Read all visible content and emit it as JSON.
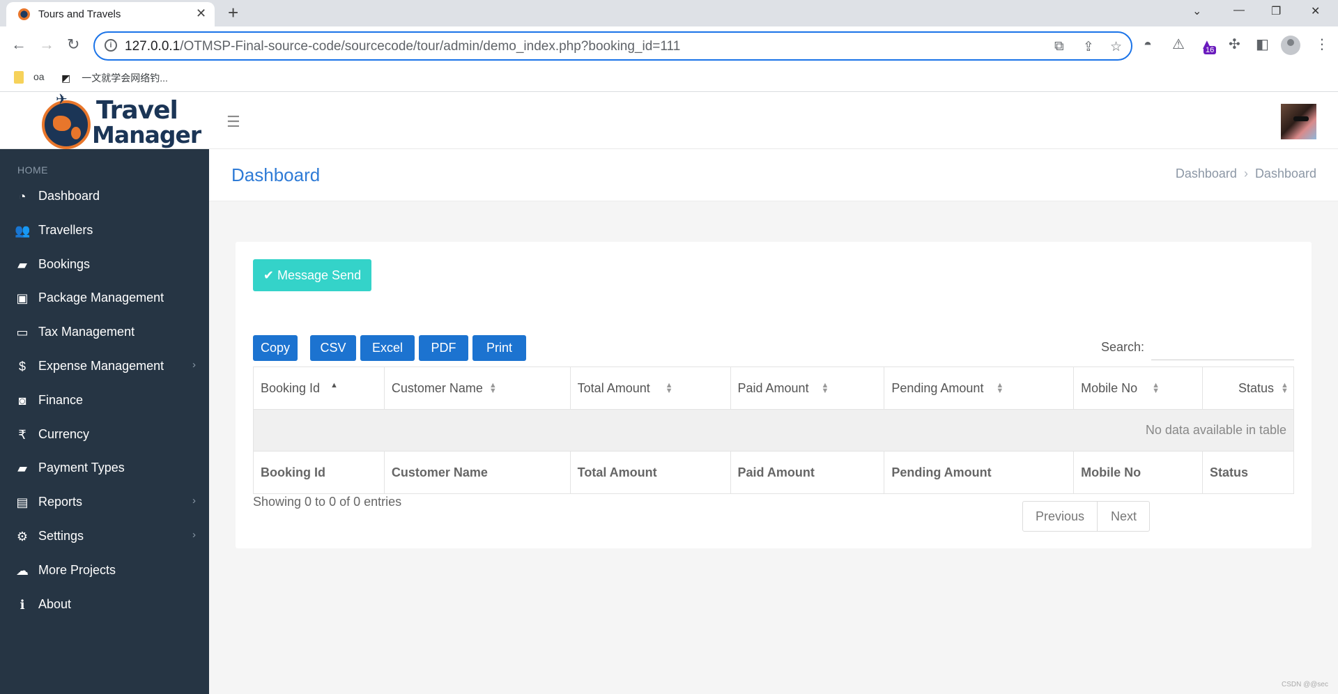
{
  "browser": {
    "tab_title": "Tours and Travels",
    "url_host": "127.0.0.1",
    "url_path": "/OTMSP-Final-source-code/sourcecode/tour/admin/demo_index.php?booking_id=111",
    "extension_badge": "16",
    "bookmarks": [
      {
        "label": "oa"
      },
      {
        "label": "一文就学会网络钓..."
      }
    ]
  },
  "app": {
    "logo_line1": "Travel",
    "logo_line2": "Manager"
  },
  "sidebar": {
    "header": "HOME",
    "items": [
      {
        "label": "Dashboard",
        "icon": "tachometer-icon",
        "glyph": "◔",
        "has_submenu": false
      },
      {
        "label": "Travellers",
        "icon": "users-icon",
        "glyph": "👥",
        "has_submenu": false
      },
      {
        "label": "Bookings",
        "icon": "book-icon",
        "glyph": "▰",
        "has_submenu": false
      },
      {
        "label": "Package Management",
        "icon": "suitcase-icon",
        "glyph": "▣",
        "has_submenu": false
      },
      {
        "label": "Tax Management",
        "icon": "credit-card-icon",
        "glyph": "▭",
        "has_submenu": false
      },
      {
        "label": "Expense Management",
        "icon": "dollar-icon",
        "glyph": "$",
        "has_submenu": true
      },
      {
        "label": "Finance",
        "icon": "money-icon",
        "glyph": "◙",
        "has_submenu": false
      },
      {
        "label": "Currency",
        "icon": "rupee-icon",
        "glyph": "₹",
        "has_submenu": false
      },
      {
        "label": "Payment Types",
        "icon": "book-icon",
        "glyph": "▰",
        "has_submenu": false
      },
      {
        "label": "Reports",
        "icon": "sticky-note-icon",
        "glyph": "▤",
        "has_submenu": true
      },
      {
        "label": "Settings",
        "icon": "gear-icon",
        "glyph": "⚙",
        "has_submenu": true
      },
      {
        "label": "More Projects",
        "icon": "cloud-download-icon",
        "glyph": "☁",
        "has_submenu": false
      },
      {
        "label": "About",
        "icon": "info-circle-icon",
        "glyph": "ℹ",
        "has_submenu": false
      }
    ]
  },
  "page": {
    "title": "Dashboard",
    "breadcrumb": [
      "Dashboard",
      "Dashboard"
    ]
  },
  "card": {
    "message_button": "Message Send",
    "export_buttons": [
      "Copy",
      "CSV",
      "Excel",
      "PDF",
      "Print"
    ],
    "search_label": "Search:",
    "search_value": "",
    "columns": [
      "Booking Id",
      "Customer Name",
      "Total Amount",
      "Paid Amount",
      "Pending Amount",
      "Mobile No",
      "Status"
    ],
    "empty_message": "No data available in table",
    "info": "Showing 0 to 0 of 0 entries",
    "pagination": {
      "previous": "Previous",
      "next": "Next"
    }
  },
  "watermark": "CSDN @@sec",
  "colors": {
    "sidebar_bg": "#263544",
    "accent_blue": "#1c73d0",
    "message_button": "#34d3c9",
    "title_blue": "#2f7bd6"
  }
}
